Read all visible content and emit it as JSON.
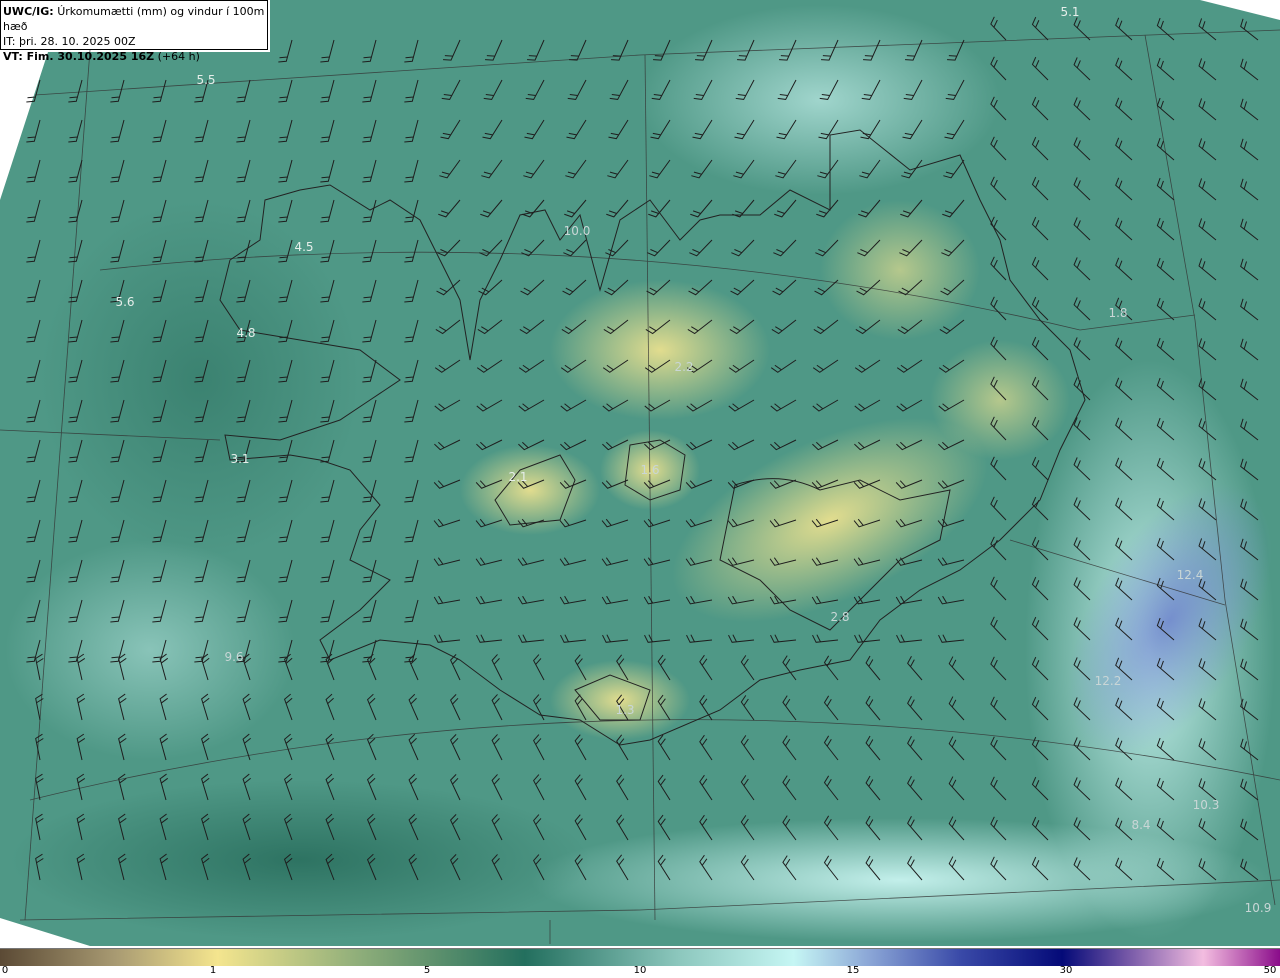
{
  "header": {
    "model_label": "UWC/IG:",
    "title": "Úrkomumætti (mm) og vindur í 100m hæð",
    "init_time": "IT: þri. 28. 10. 2025 00Z",
    "valid_label": "VT: Fim. 30.10.2025 16Z",
    "lead_time": "(+64 h)"
  },
  "values": [
    "5.1",
    "5.5",
    "4.5",
    "5.6",
    "4.8",
    "10.0",
    "2.2",
    "3.1",
    "2.1",
    "1.6",
    "9.6",
    "1.3",
    "2.8",
    "1.8",
    "12.4",
    "12.2",
    "10.3",
    "8.4",
    "10.9"
  ],
  "colorbar": {
    "ticks": [
      "0",
      "1",
      "5",
      "10",
      "15",
      "30",
      "50"
    ],
    "colors": [
      "#5b4a35",
      "#f4e58e",
      "#236f5e",
      "#c6f6f4",
      "#040a78",
      "#f3bde0",
      "#8a0c8a"
    ]
  }
}
